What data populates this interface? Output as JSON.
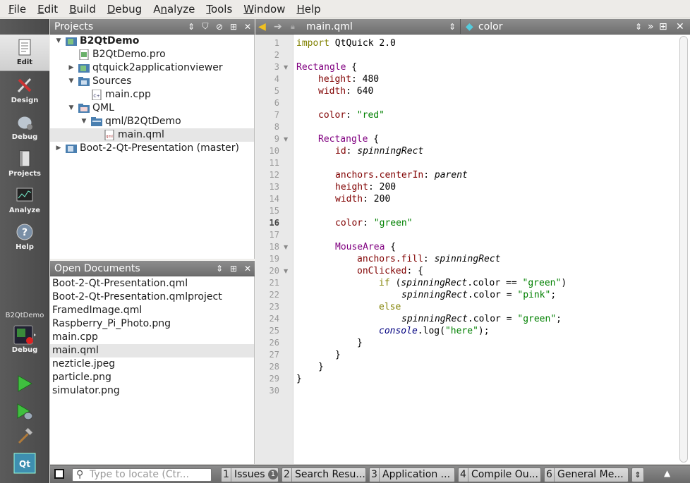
{
  "menubar": {
    "items": [
      {
        "pre": "",
        "ul": "F",
        "post": "ile"
      },
      {
        "pre": "",
        "ul": "E",
        "post": "dit"
      },
      {
        "pre": "",
        "ul": "B",
        "post": "uild"
      },
      {
        "pre": "",
        "ul": "D",
        "post": "ebug"
      },
      {
        "pre": "A",
        "ul": "n",
        "post": "alyze"
      },
      {
        "pre": "",
        "ul": "T",
        "post": "ools"
      },
      {
        "pre": "",
        "ul": "W",
        "post": "indow"
      },
      {
        "pre": "",
        "ul": "H",
        "post": "elp"
      }
    ]
  },
  "modebar": {
    "modes": [
      "Edit",
      "Design",
      "Debug",
      "Projects",
      "Analyze",
      "Help"
    ],
    "kit_project": "B2QtDemo",
    "kit_mode": "Debug"
  },
  "projects": {
    "title": "Projects",
    "tree": [
      {
        "label": "B2QtDemo",
        "arrow": "▼",
        "icon": "qt-project-icon"
      },
      {
        "label": "B2QtDemo.pro",
        "arrow": "",
        "icon": "pro-file-icon"
      },
      {
        "label": "qtquick2applicationviewer",
        "arrow": "▶",
        "icon": "qt-project-icon"
      },
      {
        "label": "Sources",
        "arrow": "▼",
        "icon": "cpp-folder-icon"
      },
      {
        "label": "main.cpp",
        "arrow": "",
        "icon": "cpp-file-icon"
      },
      {
        "label": "QML",
        "arrow": "▼",
        "icon": "qml-folder-icon"
      },
      {
        "label": "qml/B2QtDemo",
        "arrow": "▼",
        "icon": "folder-icon"
      },
      {
        "label": "main.qml",
        "arrow": "",
        "icon": "qml-file-icon"
      },
      {
        "label": "Boot-2-Qt-Presentation (master)",
        "arrow": "▶",
        "icon": "qt-project-icon"
      }
    ]
  },
  "open_documents": {
    "title": "Open Documents",
    "items": [
      "Boot-2-Qt-Presentation.qml",
      "Boot-2-Qt-Presentation.qmlproject",
      "FramedImage.qml",
      "Raspberry_Pi_Photo.png",
      "main.cpp",
      "main.qml",
      "nezticle.jpeg",
      "particle.png",
      "simulator.png"
    ],
    "selected": "main.qml"
  },
  "editor": {
    "file": "main.qml",
    "symbol": "color",
    "current_line": "16",
    "line_numbers": [
      "1",
      "2",
      "3",
      "4",
      "5",
      "6",
      "7",
      "8",
      "9",
      "10",
      "11",
      "12",
      "13",
      "14",
      "15",
      "16",
      "17",
      "18",
      "19",
      "20",
      "21",
      "22",
      "23",
      "24",
      "25",
      "26",
      "27",
      "28",
      "29",
      "30"
    ],
    "code": {
      "l1_kw": "import",
      "l1_rest": " QtQuick 2.0",
      "rect": "Rectangle",
      "brace_open": " {",
      "height": "height",
      "width": "width",
      "color": "color",
      "v480": ": 480",
      "v640": ": 640",
      "v200": ": 200",
      "sep": ": ",
      "red": "\"red\"",
      "green": "\"green\"",
      "pink": "\"pink\"",
      "id": "id",
      "spinningRect": "spinningRect",
      "anchors_centerIn": "anchors.centerIn",
      "parent": "parent",
      "mousearea": "MouseArea",
      "anchors_fill": "anchors.fill",
      "onClicked": "onClicked",
      "if_kw": "if",
      "paren_open": " (",
      "color_eq": ".color == ",
      "paren_close": ")",
      "color_assign": ".color = ",
      "semicolon": ";",
      "else_kw": "else",
      "console": "console",
      "log_open": ".log(",
      "here": "\"here\"",
      "log_close": ");",
      "brace_close": "}"
    }
  },
  "statusbar": {
    "locator_placeholder": "Type to locate (Ctr...",
    "tabs": [
      {
        "num": "1",
        "label": "Issues",
        "badge": "1"
      },
      {
        "num": "2",
        "label": "Search Resu..."
      },
      {
        "num": "3",
        "label": "Application ..."
      },
      {
        "num": "4",
        "label": "Compile Ou..."
      },
      {
        "num": "6",
        "label": "General Me..."
      }
    ]
  }
}
